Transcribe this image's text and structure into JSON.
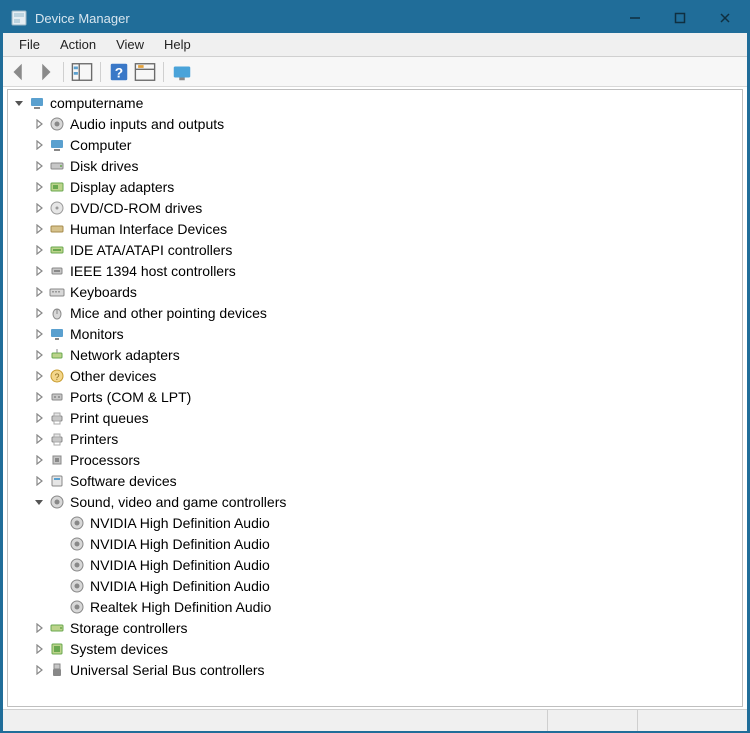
{
  "window": {
    "title": "Device Manager"
  },
  "menubar": {
    "file": "File",
    "action": "Action",
    "view": "View",
    "help": "Help"
  },
  "tree": {
    "root": {
      "label": "computername",
      "expanded": true
    },
    "categories": [
      {
        "label": "Audio inputs and outputs",
        "icon": "speaker",
        "expanded": false
      },
      {
        "label": "Computer",
        "icon": "computer",
        "expanded": false
      },
      {
        "label": "Disk drives",
        "icon": "disk",
        "expanded": false
      },
      {
        "label": "Display adapters",
        "icon": "display-adapter",
        "expanded": false
      },
      {
        "label": "DVD/CD-ROM drives",
        "icon": "cd",
        "expanded": false
      },
      {
        "label": "Human Interface Devices",
        "icon": "hid",
        "expanded": false
      },
      {
        "label": "IDE ATA/ATAPI controllers",
        "icon": "ide",
        "expanded": false
      },
      {
        "label": "IEEE 1394 host controllers",
        "icon": "firewire",
        "expanded": false
      },
      {
        "label": "Keyboards",
        "icon": "keyboard",
        "expanded": false
      },
      {
        "label": "Mice and other pointing devices",
        "icon": "mouse",
        "expanded": false
      },
      {
        "label": "Monitors",
        "icon": "monitor",
        "expanded": false
      },
      {
        "label": "Network adapters",
        "icon": "network",
        "expanded": false
      },
      {
        "label": "Other devices",
        "icon": "other",
        "expanded": false
      },
      {
        "label": "Ports (COM & LPT)",
        "icon": "port",
        "expanded": false
      },
      {
        "label": "Print queues",
        "icon": "printer",
        "expanded": false
      },
      {
        "label": "Printers",
        "icon": "printer",
        "expanded": false
      },
      {
        "label": "Processors",
        "icon": "cpu",
        "expanded": false
      },
      {
        "label": "Software devices",
        "icon": "software",
        "expanded": false
      },
      {
        "label": "Sound, video and game controllers",
        "icon": "speaker",
        "expanded": true,
        "children": [
          {
            "label": "NVIDIA High Definition Audio",
            "icon": "speaker"
          },
          {
            "label": "NVIDIA High Definition Audio",
            "icon": "speaker"
          },
          {
            "label": "NVIDIA High Definition Audio",
            "icon": "speaker"
          },
          {
            "label": "NVIDIA High Definition Audio",
            "icon": "speaker"
          },
          {
            "label": "Realtek High Definition Audio",
            "icon": "speaker"
          }
        ]
      },
      {
        "label": "Storage controllers",
        "icon": "storage",
        "expanded": false
      },
      {
        "label": "System devices",
        "icon": "system",
        "expanded": false
      },
      {
        "label": "Universal Serial Bus controllers",
        "icon": "usb",
        "expanded": false
      }
    ]
  }
}
